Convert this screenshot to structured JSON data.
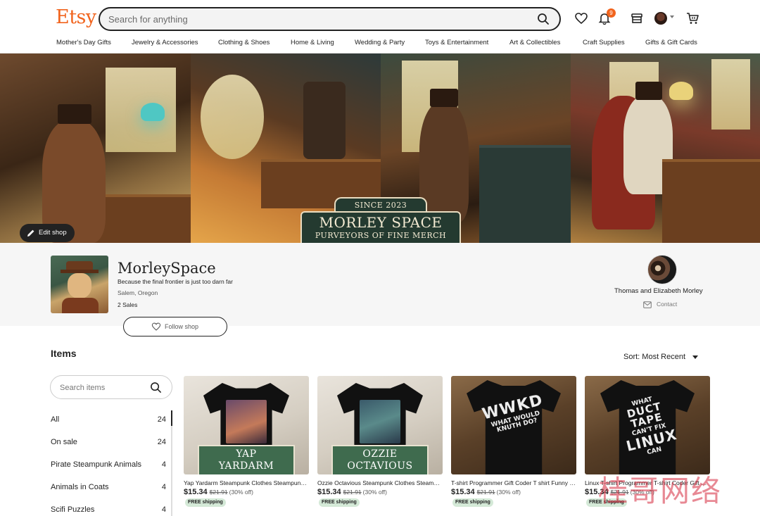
{
  "header": {
    "logo": "Etsy",
    "search_placeholder": "Search for anything",
    "notification_count": "9",
    "icons": [
      "heart-icon",
      "bell-icon",
      "shop-icon",
      "avatar",
      "cart-icon"
    ]
  },
  "nav": {
    "items": [
      "Mother's Day Gifts",
      "Jewelry & Accessories",
      "Clothing & Shoes",
      "Home & Living",
      "Wedding & Party",
      "Toys & Entertainment",
      "Art & Collectibles",
      "Craft Supplies",
      "Gifts & Gift Cards"
    ]
  },
  "banner": {
    "sign_top": "SINCE 2023",
    "sign_title": "MORLEY SPACE",
    "sign_sub": "PURVEYORS OF FINE MERCH",
    "edit_shop": "Edit shop"
  },
  "shop": {
    "name": "MorleySpace",
    "tagline": "Because the final frontier is just too darn far",
    "location": "Salem, Oregon",
    "sales": "2 Sales",
    "follow": "Follow shop",
    "owner": "Thomas and Elizabeth Morley",
    "contact": "Contact"
  },
  "items": {
    "title": "Items",
    "sort": "Sort: Most Recent",
    "search_placeholder": "Search items",
    "sections": [
      {
        "label": "All",
        "count": "24"
      },
      {
        "label": "On sale",
        "count": "24"
      },
      {
        "label": "Pirate Steampunk Animals",
        "count": "4"
      },
      {
        "label": "Animals in Coats",
        "count": "4"
      },
      {
        "label": "Scifi Puzzles",
        "count": "4"
      }
    ],
    "listings": [
      {
        "shirt_label": [
          "YAP",
          "YARDARM"
        ],
        "title": "Yap Yardarm Steampunk Clothes Steampunk Pirate Tee",
        "price": "$15.34",
        "original": "$21.91",
        "discount": "(30% off)",
        "shipping": "FREE shipping"
      },
      {
        "shirt_label": [
          "OZZIE",
          "OCTAVIOUS"
        ],
        "title": "Ozzie Octavious Steampunk Clothes Steampunk Octopus Tee",
        "price": "$15.34",
        "original": "$21.91",
        "discount": "(30% off)",
        "shipping": "FREE shipping"
      },
      {
        "shirt_text": [
          "WWKD",
          "WHAT WOULD KNUTH DO?"
        ],
        "title": "T-shirt Programmer Gift Coder T shirt Funny Computer Tee",
        "price": "$15.34",
        "original": "$21.91",
        "discount": "(30% off)",
        "shipping": "FREE shipping"
      },
      {
        "shirt_text": [
          "WHAT",
          "DUCT TAPE",
          "CAN'T FIX",
          "LINUX",
          "CAN"
        ],
        "title": "Linux T-shirt Programmer T-shirt Coder Gift Funny Tee",
        "price": "$15.34",
        "original": "$21.91",
        "discount": "(30% off)",
        "shipping": "FREE shipping"
      }
    ]
  },
  "watermark": "桂哥网络",
  "colors": {
    "brand": "#f1641e",
    "sign_green": "#243a30",
    "label_green": "#3f6b4e",
    "free_shipping_bg": "#d4e9d7"
  }
}
